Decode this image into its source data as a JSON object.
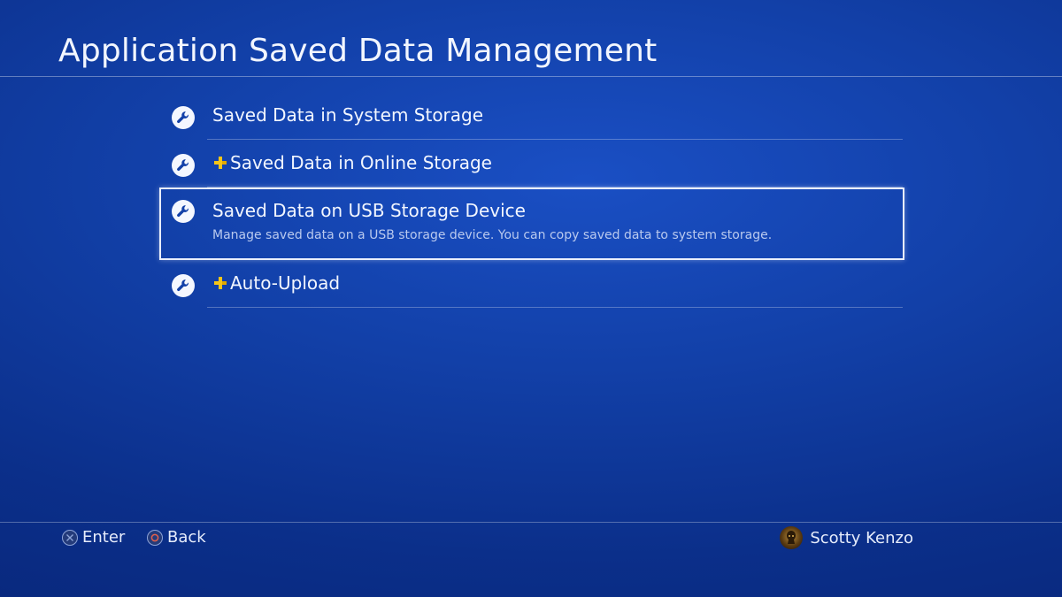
{
  "header": {
    "title": "Application Saved Data Management"
  },
  "menu": {
    "items": [
      {
        "label": "Saved Data in System Storage",
        "plus": false,
        "icon": "wrench-icon"
      },
      {
        "label": "Saved Data in Online Storage",
        "plus": true,
        "icon": "wrench-icon"
      },
      {
        "label": "Saved Data on USB Storage Device",
        "plus": false,
        "icon": "wrench-icon",
        "selected": true,
        "description": "Manage saved data on a USB storage device. You can copy saved data to system storage."
      },
      {
        "label": "Auto-Upload",
        "plus": true,
        "icon": "wrench-icon"
      }
    ]
  },
  "footer": {
    "enter_label": "Enter",
    "back_label": "Back",
    "username": "Scotty Kenzo"
  },
  "colors": {
    "background": "#1240a8",
    "plus_gold": "#f5c518",
    "cross_button": "#8ea4d8",
    "circle_button": "#e0604c"
  }
}
